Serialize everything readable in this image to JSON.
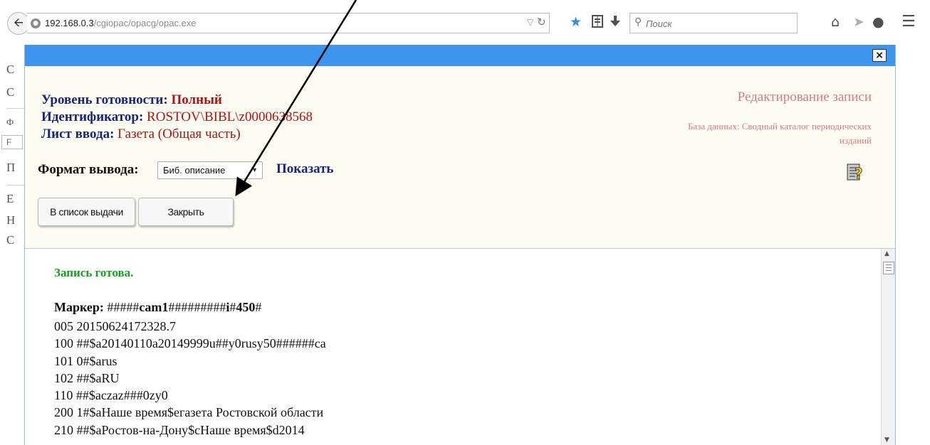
{
  "browser": {
    "url_host": "192.168.0.3",
    "url_path": "/cgiopac/opacg/opac.exe",
    "search_placeholder": "Поиск",
    "icons": {
      "back": "back-arrow-icon",
      "site": "globe-icon",
      "dropdown": "chevron-down-icon",
      "reload": "reload-icon",
      "bookmark": "star-icon",
      "reading_list": "reading-list-icon",
      "download": "download-icon",
      "search": "search-icon",
      "home": "home-icon",
      "send": "send-icon",
      "chat": "chat-icon",
      "menu": "hamburger-menu-icon"
    }
  },
  "background_page": {
    "letters": [
      "С",
      "С",
      "Ф",
      "Г",
      "П",
      "Е",
      "Н",
      "С"
    ],
    "input_text": "F"
  },
  "dialog": {
    "close_symbol": "×",
    "readiness": {
      "label": "Уровень готовности:",
      "value": "Полный"
    },
    "identifier": {
      "label": "Идентификатор:",
      "value": "ROSTOV\\BIBL\\z0000638568"
    },
    "input_sheet": {
      "label": "Лист ввода:",
      "value": "Газета (Общая часть)"
    },
    "edit_title": "Редактирование записи",
    "database": "База данных: Сводный каталог периодических изданий",
    "format_label": "Формат вывода:",
    "format_value": "Биб. описание",
    "show_link": "Показать",
    "help_icon": "help-book-icon",
    "buttons": {
      "issue_list": "В список выдачи",
      "close": "Закрыть"
    },
    "record": {
      "status": "Запись готова.",
      "marker_label": "Маркер:",
      "marker_value": {
        "p1": "#####",
        "p2": "cam1",
        "p3": "#########",
        "p4": "i",
        "p5": "#",
        "p6": "450",
        "p7": "#"
      },
      "fields": [
        "005 20150624172328.7",
        "100 ##$a20140110a20149999u##y0rusy50######ca",
        "101 0#$arus",
        "102 ##$aRU",
        "110 ##$aczaz###0zy0",
        "200 1#$aНаше время$eгазета Ростовской области",
        "210 ##$aРостов-на-Дону$cНаше время$d2014"
      ]
    }
  },
  "colors": {
    "titlebar": "#3d95ee",
    "label_blue": "#1a237e",
    "value_red": "#b21212",
    "pink": "#d9788a",
    "status_green": "#16a01e",
    "dialog_bg": "#fcfcf2"
  }
}
